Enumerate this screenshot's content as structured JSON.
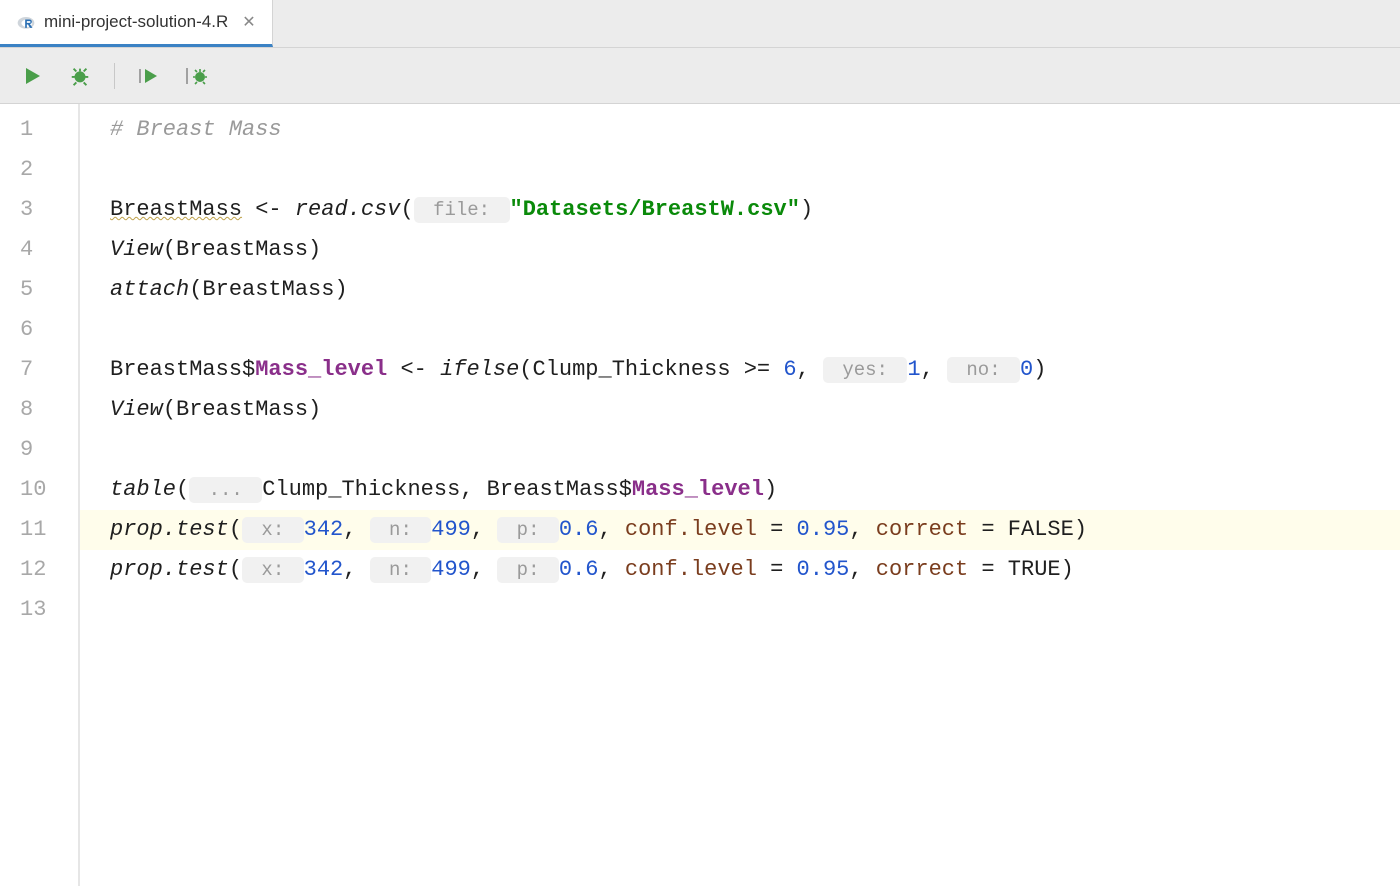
{
  "tab": {
    "filename": "mini-project-solution-4.R"
  },
  "gutter": {
    "lines": [
      "1",
      "2",
      "3",
      "4",
      "5",
      "6",
      "7",
      "8",
      "9",
      "10",
      "11",
      "12",
      "13"
    ]
  },
  "code": {
    "l1_comment": "# Breast Mass",
    "l3": {
      "var": "BreastMass",
      "assign": " <- ",
      "fn": "read.csv",
      "open": "(",
      "hint": " file: ",
      "str": "\"Datasets/BreastW.csv\"",
      "close": ")"
    },
    "l4": {
      "fn": "View",
      "arg": "(BreastMass)"
    },
    "l5": {
      "fn": "attach",
      "arg": "(BreastMass)"
    },
    "l7": {
      "lhs": "BreastMass$",
      "member": "Mass_level",
      "assign": " <- ",
      "fn": "ifelse",
      "open": "(Clump_Thickness >= ",
      "n6": "6",
      "sep1": ", ",
      "hint_yes": " yes: ",
      "n1": "1",
      "sep2": ", ",
      "hint_no": " no: ",
      "n0": "0",
      "close": ")"
    },
    "l8": {
      "fn": "View",
      "arg": "(BreastMass)"
    },
    "l10": {
      "fn": "table",
      "open": "(",
      "hint_ell": " ... ",
      "mid": "Clump_Thickness, BreastMass$",
      "member": "Mass_level",
      "close": ")"
    },
    "l11": {
      "fn": "prop.test",
      "open": "(",
      "hx": " x: ",
      "n342": "342",
      "s1": ", ",
      "hn": " n: ",
      "n499": "499",
      "s2": ", ",
      "hp": " p: ",
      "p06": "0.6",
      "s3": ", ",
      "cl1": "conf.level",
      "eq1": " = ",
      "v095": "0.95",
      "s4": ", ",
      "cr1": "correct",
      "eq2": " = ",
      "vFalse": "FALSE",
      "close": ")"
    },
    "l12": {
      "fn": "prop.test",
      "open": "(",
      "hx": " x: ",
      "n342": "342",
      "s1": ", ",
      "hn": " n: ",
      "n499": "499",
      "s2": ", ",
      "hp": " p: ",
      "p06": "0.6",
      "s3": ", ",
      "cl1": "conf.level",
      "eq1": " = ",
      "v095": "0.95",
      "s4": ", ",
      "cr1": "correct",
      "eq2": " = ",
      "vTrue": "TRUE",
      "close": ")"
    }
  }
}
